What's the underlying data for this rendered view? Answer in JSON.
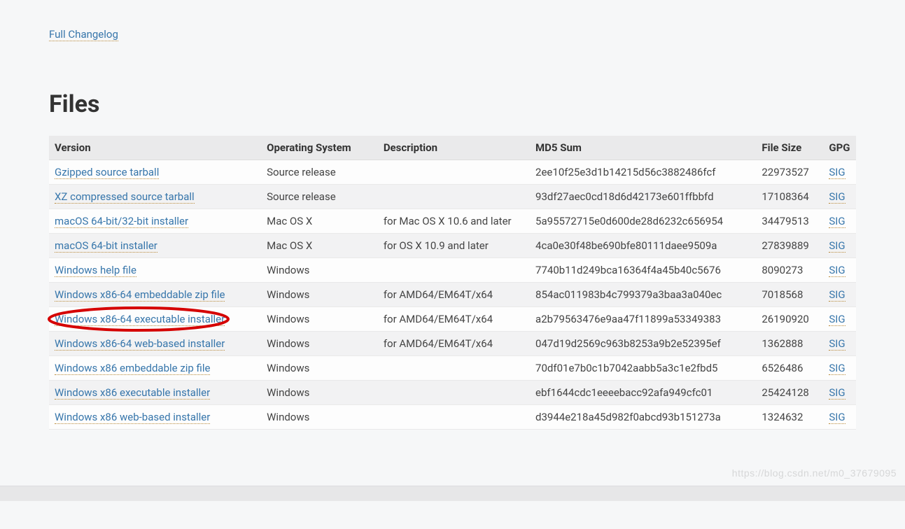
{
  "links": {
    "full_changelog": "Full Changelog"
  },
  "heading": "Files",
  "table": {
    "columns": [
      "Version",
      "Operating System",
      "Description",
      "MD5 Sum",
      "File Size",
      "GPG"
    ],
    "rows": [
      {
        "version": "Gzipped source tarball",
        "os": "Source release",
        "desc": "",
        "md5": "2ee10f25e3d1b14215d56c3882486fcf",
        "size": "22973527",
        "gpg": "SIG",
        "highlight": false
      },
      {
        "version": "XZ compressed source tarball",
        "os": "Source release",
        "desc": "",
        "md5": "93df27aec0cd18d6d42173e601ffbbfd",
        "size": "17108364",
        "gpg": "SIG",
        "highlight": false
      },
      {
        "version": "macOS 64-bit/32-bit installer",
        "os": "Mac OS X",
        "desc": "for Mac OS X 10.6 and later",
        "md5": "5a95572715e0d600de28d6232c656954",
        "size": "34479513",
        "gpg": "SIG",
        "highlight": false
      },
      {
        "version": "macOS 64-bit installer",
        "os": "Mac OS X",
        "desc": "for OS X 10.9 and later",
        "md5": "4ca0e30f48be690bfe80111daee9509a",
        "size": "27839889",
        "gpg": "SIG",
        "highlight": false
      },
      {
        "version": "Windows help file",
        "os": "Windows",
        "desc": "",
        "md5": "7740b11d249bca16364f4a45b40c5676",
        "size": "8090273",
        "gpg": "SIG",
        "highlight": false
      },
      {
        "version": "Windows x86-64 embeddable zip file",
        "os": "Windows",
        "desc": "for AMD64/EM64T/x64",
        "md5": "854ac011983b4c799379a3baa3a040ec",
        "size": "7018568",
        "gpg": "SIG",
        "highlight": false
      },
      {
        "version": "Windows x86-64 executable installer",
        "os": "Windows",
        "desc": "for AMD64/EM64T/x64",
        "md5": "a2b79563476e9aa47f11899a53349383",
        "size": "26190920",
        "gpg": "SIG",
        "highlight": true
      },
      {
        "version": "Windows x86-64 web-based installer",
        "os": "Windows",
        "desc": "for AMD64/EM64T/x64",
        "md5": "047d19d2569c963b8253a9b2e52395ef",
        "size": "1362888",
        "gpg": "SIG",
        "highlight": false
      },
      {
        "version": "Windows x86 embeddable zip file",
        "os": "Windows",
        "desc": "",
        "md5": "70df01e7b0c1b7042aabb5a3c1e2fbd5",
        "size": "6526486",
        "gpg": "SIG",
        "highlight": false
      },
      {
        "version": "Windows x86 executable installer",
        "os": "Windows",
        "desc": "",
        "md5": "ebf1644cdc1eeeebacc92afa949cfc01",
        "size": "25424128",
        "gpg": "SIG",
        "highlight": false
      },
      {
        "version": "Windows x86 web-based installer",
        "os": "Windows",
        "desc": "",
        "md5": "d3944e218a45d982f0abcd93b151273a",
        "size": "1324632",
        "gpg": "SIG",
        "highlight": false
      }
    ]
  },
  "watermark": "https://blog.csdn.net/m0_37679095"
}
